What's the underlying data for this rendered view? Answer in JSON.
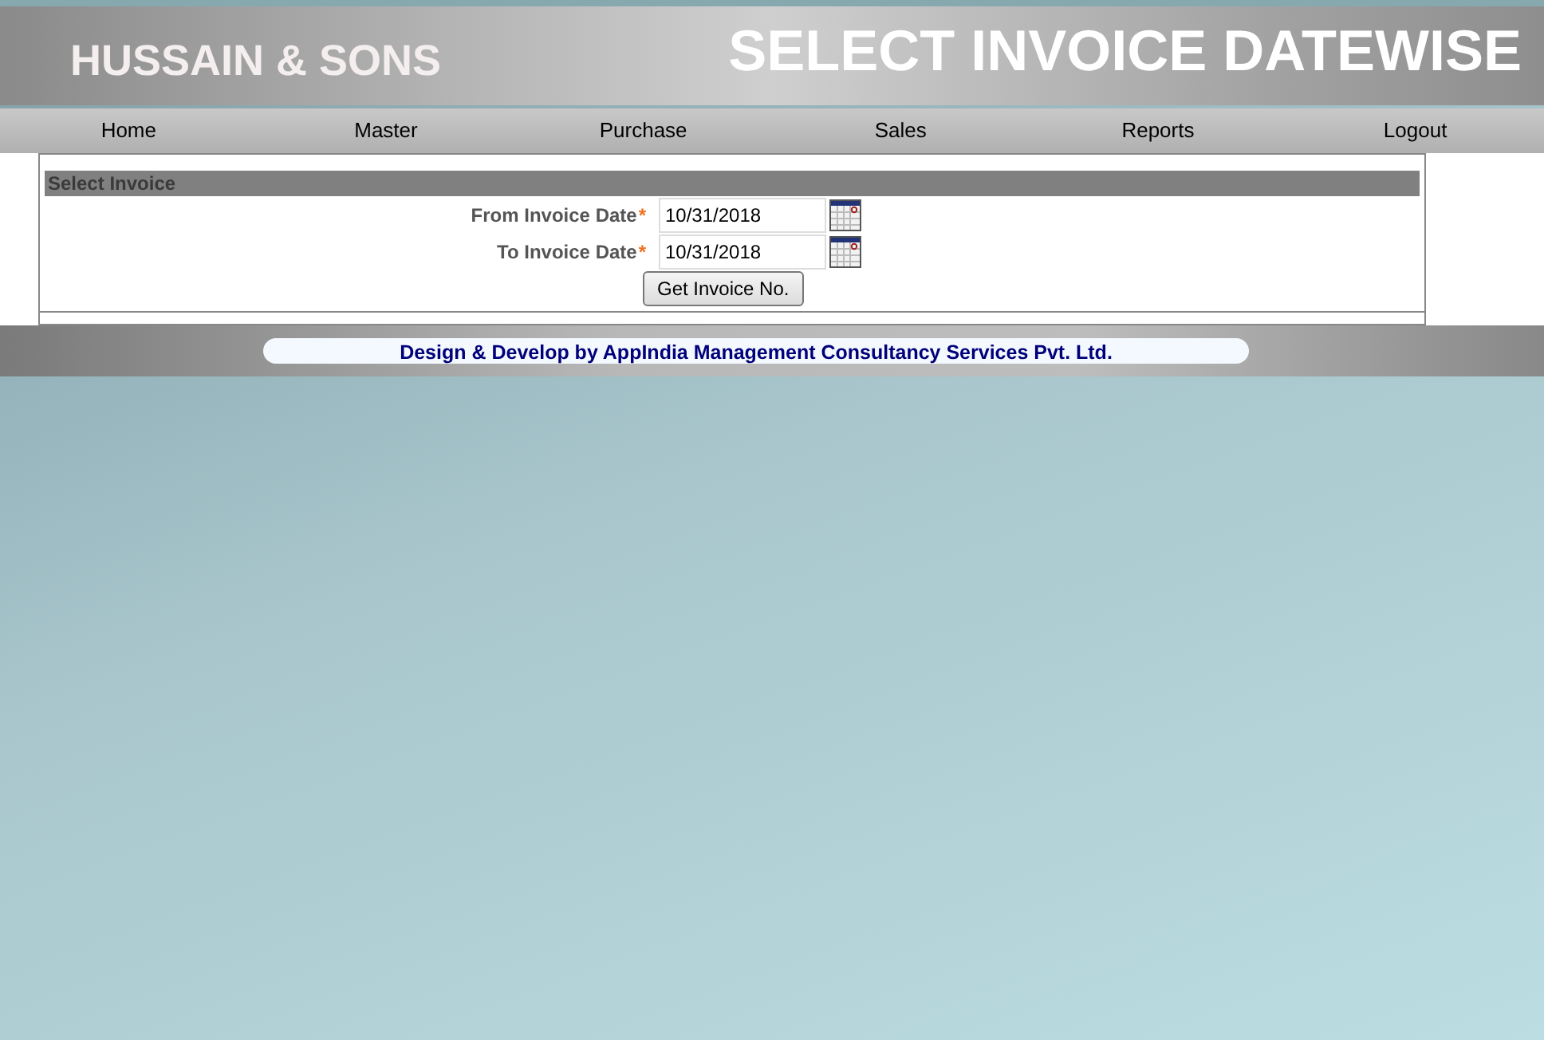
{
  "header": {
    "company": "HUSSAIN & SONS",
    "title": "SELECT INVOICE DATEWISE"
  },
  "menu": [
    {
      "label": "Home"
    },
    {
      "label": "Master"
    },
    {
      "label": "Purchase"
    },
    {
      "label": "Sales"
    },
    {
      "label": "Reports"
    },
    {
      "label": "Logout"
    }
  ],
  "panel": {
    "heading": "Select Invoice",
    "fields": [
      {
        "label": "From Invoice Date",
        "required_mark": "*",
        "value": "10/31/2018"
      },
      {
        "label": "To Invoice Date",
        "required_mark": "*",
        "value": "10/31/2018"
      }
    ],
    "button": "Get Invoice No."
  },
  "footer": "Design & Develop by AppIndia Management Consultancy Services Pvt. Ltd."
}
